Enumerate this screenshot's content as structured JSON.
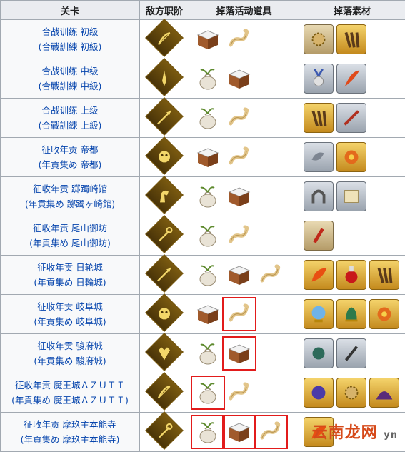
{
  "headers": [
    "关卡",
    "敌方职阶",
    "掉落活动道具",
    "掉落素材"
  ],
  "rows": [
    {
      "stage_cn": "合战训练 初级",
      "stage_jp": "(合戰訓練 初級)",
      "class_icon": "archer-class-icon",
      "drops": [
        {
          "icon": "box-icon",
          "hl": false
        },
        {
          "icon": "rope-icon",
          "hl": false
        }
      ],
      "mats": [
        {
          "icon": "gear-material-icon",
          "tone": "b"
        },
        {
          "icon": "claw-material-icon",
          "tone": "g"
        }
      ]
    },
    {
      "stage_cn": "合战训练 中级",
      "stage_jp": "(合戰訓練 中級)",
      "class_icon": "saber-class-icon",
      "drops": [
        {
          "icon": "sack-icon",
          "hl": false
        },
        {
          "icon": "box-icon",
          "hl": false
        }
      ],
      "mats": [
        {
          "icon": "medal-material-icon",
          "tone": "s"
        },
        {
          "icon": "feather-material-icon",
          "tone": "s"
        }
      ]
    },
    {
      "stage_cn": "合战训练 上级",
      "stage_jp": "(合戰訓練 上級)",
      "class_icon": "lancer-class-icon",
      "drops": [
        {
          "icon": "sack-icon",
          "hl": false
        },
        {
          "icon": "rope-icon",
          "hl": false
        }
      ],
      "mats": [
        {
          "icon": "claw-material-icon",
          "tone": "g"
        },
        {
          "icon": "bone-material-icon",
          "tone": "s"
        }
      ]
    },
    {
      "stage_cn": "征收年贡 帝都",
      "stage_jp": "(年貢集め 帝都)",
      "class_icon": "berserker-class-icon",
      "drops": [
        {
          "icon": "box-icon",
          "hl": false
        },
        {
          "icon": "rope-icon",
          "hl": false
        }
      ],
      "mats": [
        {
          "icon": "serpent-material-icon",
          "tone": "s"
        },
        {
          "icon": "blossom-material-icon",
          "tone": "g"
        }
      ]
    },
    {
      "stage_cn": "征收年贡 踯躅崎馆",
      "stage_jp": "(年貢集め 躑躅ヶ崎館)",
      "class_icon": "rider-class-icon",
      "drops": [
        {
          "icon": "sack-icon",
          "hl": false
        },
        {
          "icon": "box-icon",
          "hl": false
        }
      ],
      "mats": [
        {
          "icon": "horseshoe-material-icon",
          "tone": "s"
        },
        {
          "icon": "scroll-material-icon",
          "tone": "s"
        }
      ]
    },
    {
      "stage_cn": "征收年贡 尾山御坊",
      "stage_jp": "(年貢集め 尾山御坊)",
      "class_icon": "caster-class-icon",
      "drops": [
        {
          "icon": "sack-icon",
          "hl": false
        },
        {
          "icon": "rope-icon",
          "hl": false
        }
      ],
      "mats": [
        {
          "icon": "fang-material-icon",
          "tone": "b"
        }
      ]
    },
    {
      "stage_cn": "征收年贡 日轮城",
      "stage_jp": "(年貢集め 日輪城)",
      "class_icon": "lancer-class-icon",
      "drops": [
        {
          "icon": "sack-icon",
          "hl": false
        },
        {
          "icon": "box-icon",
          "hl": false
        },
        {
          "icon": "rope-icon",
          "hl": false
        }
      ],
      "mats": [
        {
          "icon": "phoenix-feather-material-icon",
          "tone": "g"
        },
        {
          "icon": "flask-material-icon",
          "tone": "g"
        },
        {
          "icon": "claw-material-icon",
          "tone": "g"
        }
      ]
    },
    {
      "stage_cn": "征收年贡 岐阜城",
      "stage_jp": "(年貢集め 岐阜城)",
      "class_icon": "berserker-class-icon",
      "drops": [
        {
          "icon": "box-icon",
          "hl": false
        },
        {
          "icon": "rope-icon",
          "hl": true
        }
      ],
      "mats": [
        {
          "icon": "crystal-ball-material-icon",
          "tone": "g"
        },
        {
          "icon": "bell-material-icon",
          "tone": "g"
        },
        {
          "icon": "blossom-material-icon",
          "tone": "g"
        }
      ]
    },
    {
      "stage_cn": "征收年贡 骏府城",
      "stage_jp": "(年貢集め 駿府城)",
      "class_icon": "assassin-class-icon",
      "drops": [
        {
          "icon": "sack-icon",
          "hl": false
        },
        {
          "icon": "box-icon",
          "hl": true
        }
      ],
      "mats": [
        {
          "icon": "seed-material-icon",
          "tone": "s"
        },
        {
          "icon": "nail-material-icon",
          "tone": "s"
        }
      ]
    },
    {
      "stage_cn": "征收年贡 魔王城ＡＺＵＴＩ",
      "stage_jp": "(年貢集め 魔王城ＡＺＵＴＩ)",
      "class_icon": "archer-class-icon",
      "drops": [
        {
          "icon": "sack-icon",
          "hl": true
        },
        {
          "icon": "rope-icon",
          "hl": false
        }
      ],
      "mats": [
        {
          "icon": "heart-gem-material-icon",
          "tone": "g"
        },
        {
          "icon": "gear-material-icon",
          "tone": "g"
        },
        {
          "icon": "dust-material-icon",
          "tone": "g"
        }
      ]
    },
    {
      "stage_cn": "征收年贡 摩玖主本能寺",
      "stage_jp": "(年貢集め 摩玖主本能寺)",
      "class_icon": "caster-class-icon",
      "drops": [
        {
          "icon": "sack-icon",
          "hl": true
        },
        {
          "icon": "box-icon",
          "hl": true
        },
        {
          "icon": "rope-icon",
          "hl": true
        }
      ],
      "mats": [
        {
          "icon": "phoenix-feather-material-icon",
          "tone": "g"
        }
      ]
    }
  ],
  "watermark": {
    "main": "云南龙网",
    "sub": "yn"
  }
}
